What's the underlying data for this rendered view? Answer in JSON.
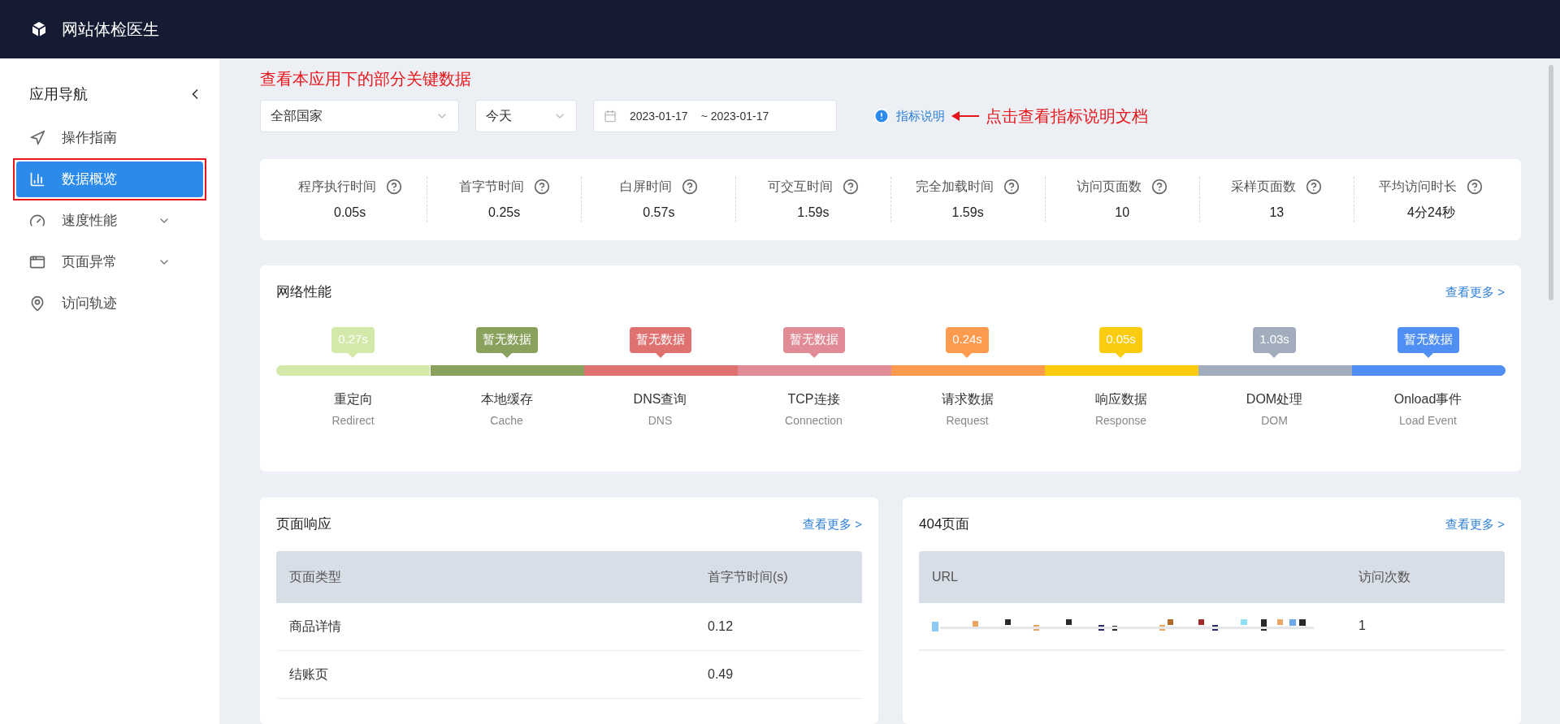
{
  "header": {
    "title": "网站体检医生"
  },
  "sidebar": {
    "title": "应用导航",
    "items": [
      {
        "label": "操作指南",
        "kind": "link",
        "selected": false
      },
      {
        "label": "数据概览",
        "kind": "link",
        "selected": true
      },
      {
        "label": "速度性能",
        "kind": "group",
        "selected": false,
        "expanded": false
      },
      {
        "label": "页面异常",
        "kind": "group",
        "selected": false,
        "expanded": false
      },
      {
        "label": "访问轨迹",
        "kind": "link",
        "selected": false
      }
    ]
  },
  "annotations": {
    "page_note": "查看本应用下的部分关键数据",
    "doc_note": "点击查看指标说明文档"
  },
  "filters": {
    "country": "全部国家",
    "period": "今天",
    "date_start": "2023-01-17",
    "date_end": "~ 2023-01-17",
    "doc_link": "指标说明"
  },
  "stats": [
    {
      "label": "程序执行时间",
      "value": "0.05s"
    },
    {
      "label": "首字节时间",
      "value": "0.25s"
    },
    {
      "label": "白屏时间",
      "value": "0.57s"
    },
    {
      "label": "可交互时间",
      "value": "1.59s"
    },
    {
      "label": "完全加载时间",
      "value": "1.59s"
    },
    {
      "label": "访问页面数",
      "value": "10"
    },
    {
      "label": "采样页面数",
      "value": "13"
    },
    {
      "label": "平均访问时长",
      "value": "4分24秒"
    }
  ],
  "network": {
    "title": "网络性能",
    "more": "查看更多 >",
    "stages": [
      {
        "badge": "0.27s",
        "name": "重定向",
        "sub": "Redirect",
        "color": "#d3e9a9"
      },
      {
        "badge": "暂无数据",
        "name": "本地缓存",
        "sub": "Cache",
        "color": "#88a15d"
      },
      {
        "badge": "暂无数据",
        "name": "DNS查询",
        "sub": "DNS",
        "color": "#df7170"
      },
      {
        "badge": "暂无数据",
        "name": "TCP连接",
        "sub": "Connection",
        "color": "#e18b96"
      },
      {
        "badge": "0.24s",
        "name": "请求数据",
        "sub": "Request",
        "color": "#fe9a4e"
      },
      {
        "badge": "0.05s",
        "name": "响应数据",
        "sub": "Response",
        "color": "#facb0f"
      },
      {
        "badge": "1.03s",
        "name": "DOM处理",
        "sub": "DOM",
        "color": "#a1acbd"
      },
      {
        "badge": "暂无数据",
        "name": "Onload事件",
        "sub": "Load Event",
        "color": "#4f8ff3"
      }
    ]
  },
  "page_response": {
    "title": "页面响应",
    "more": "查看更多 >",
    "columns": [
      "页面类型",
      "首字节时间(s)"
    ],
    "rows": [
      [
        "商品详情",
        "0.12"
      ],
      [
        "结账页",
        "0.49"
      ]
    ]
  },
  "not_found": {
    "title": "404页面",
    "more": "查看更多 >",
    "columns": [
      "URL",
      "访问次数"
    ],
    "rows": [
      {
        "visits": "1"
      }
    ]
  }
}
